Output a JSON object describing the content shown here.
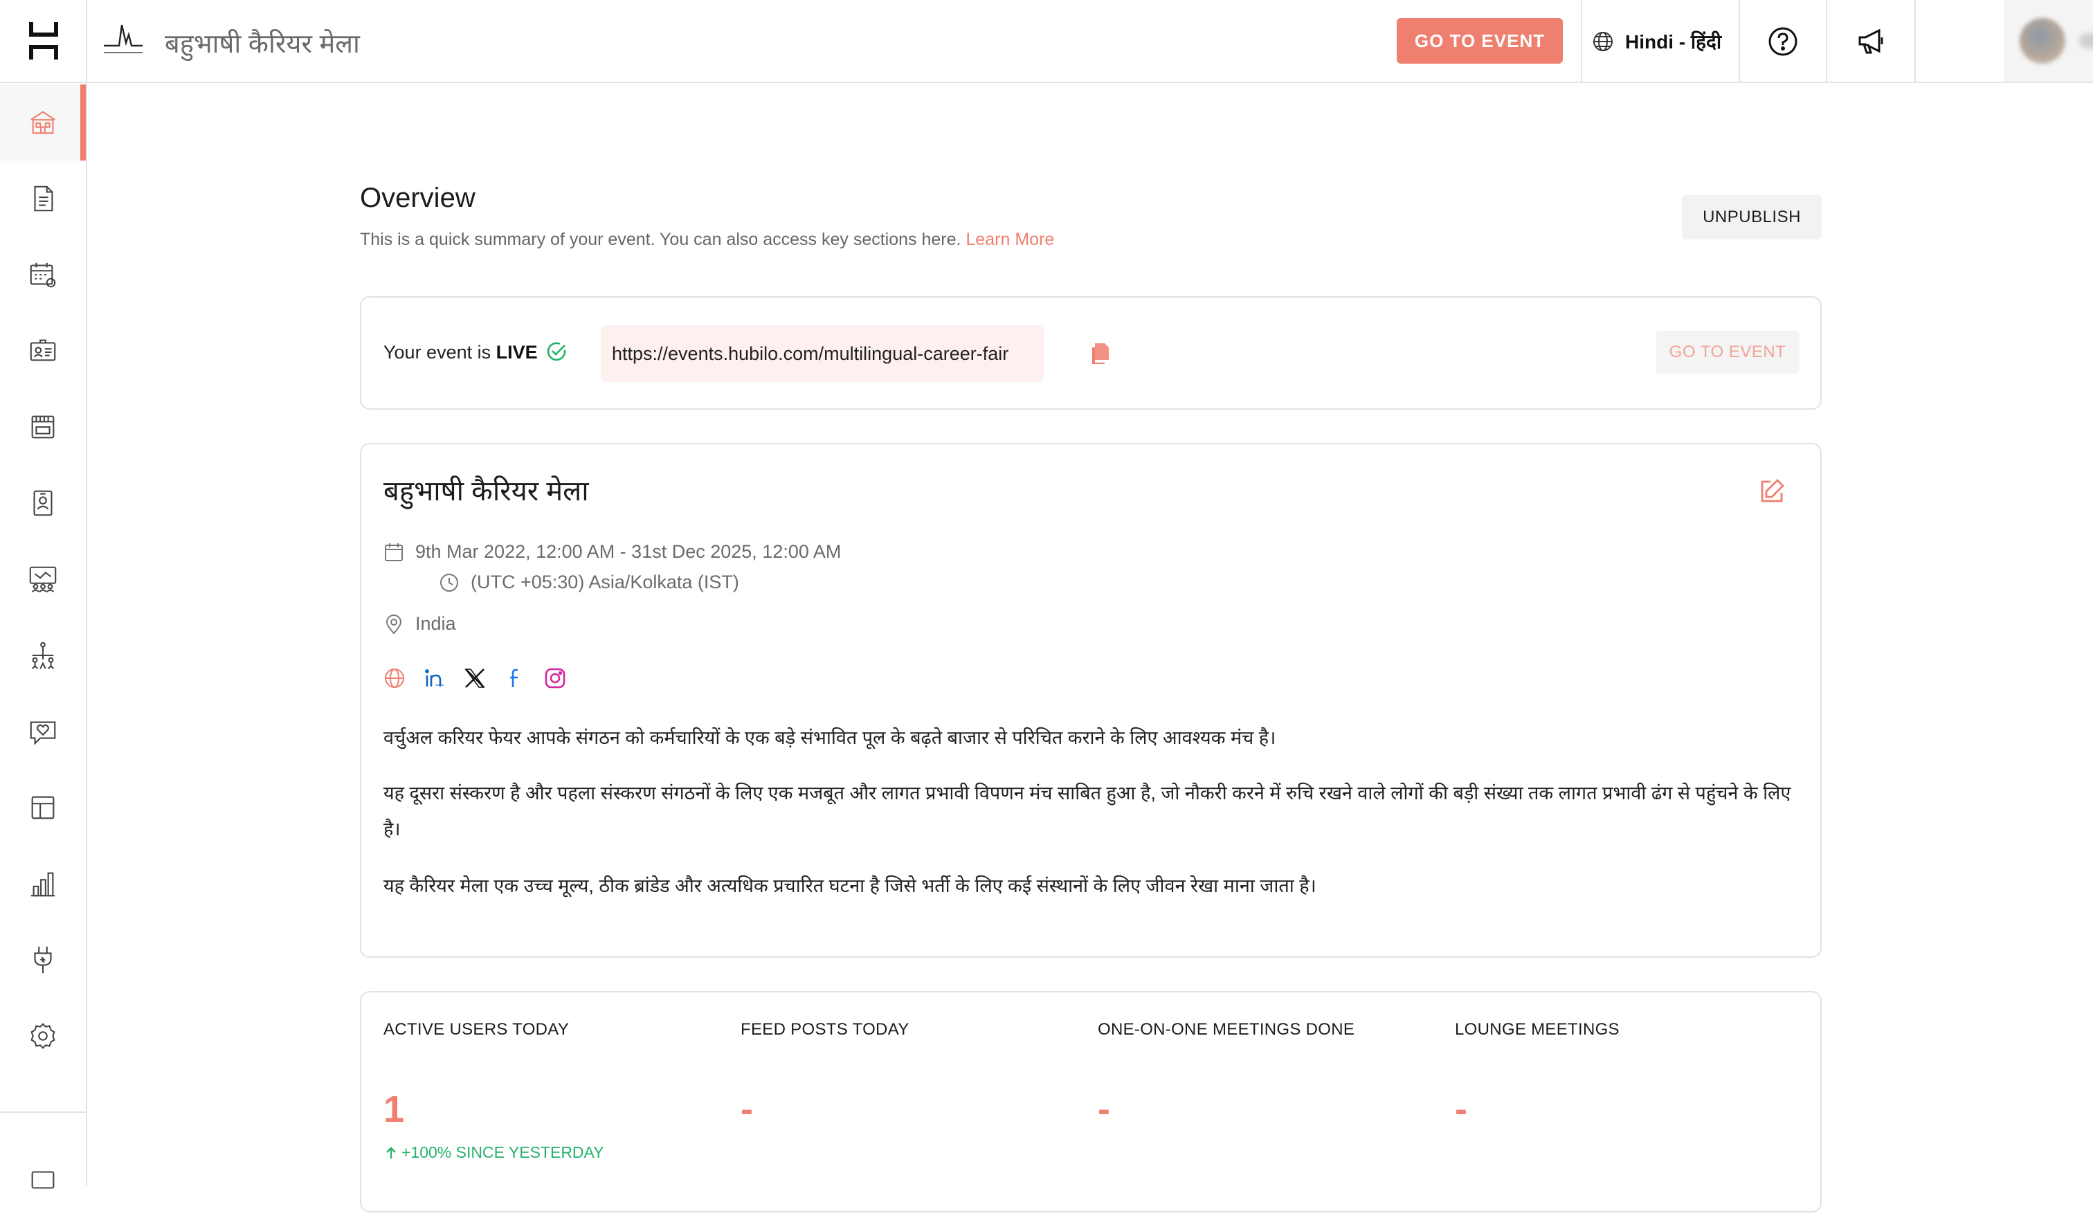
{
  "rail": {
    "items": [
      {
        "icon": "dashboard-icon",
        "active": true
      },
      {
        "icon": "document-icon",
        "active": false
      },
      {
        "icon": "calendar-settings-icon",
        "active": false
      },
      {
        "icon": "badge-icon",
        "active": false
      },
      {
        "icon": "booth-icon",
        "active": false
      },
      {
        "icon": "id-card-icon",
        "active": false
      },
      {
        "icon": "presentation-icon",
        "active": false
      },
      {
        "icon": "people-network-icon",
        "active": false
      },
      {
        "icon": "chat-heart-icon",
        "active": false
      },
      {
        "icon": "layout-icon",
        "active": false
      },
      {
        "icon": "analytics-icon",
        "active": false
      },
      {
        "icon": "plug-icon",
        "active": false
      },
      {
        "icon": "settings-icon",
        "active": false
      }
    ]
  },
  "header": {
    "event_title": "बहुभाषी कैरियर मेला",
    "go_to_event": "GO TO EVENT",
    "language": "Hindi - हिंदी"
  },
  "overview": {
    "title": "Overview",
    "subtitle": "This is a quick summary of your event. You can also access key sections here.",
    "learn_more": "Learn More",
    "unpublish": "UNPUBLISH"
  },
  "live": {
    "prefix": "Your event is ",
    "status": "LIVE",
    "url": "https://events.hubilo.com/multilingual-career-fair",
    "go_to_event": "GO TO EVENT"
  },
  "event": {
    "name": "बहुभाषी कैरियर मेला",
    "dates": "9th Mar 2022, 12:00 AM - 31st Dec 2025, 12:00 AM",
    "timezone": "(UTC +05:30) Asia/Kolkata (IST)",
    "location": "India",
    "social": [
      "website-icon",
      "linkedin-icon",
      "x-icon",
      "facebook-icon",
      "instagram-icon"
    ],
    "description": [
      "वर्चुअल करियर फेयर आपके संगठन को कर्मचारियों के एक बड़े संभावित पूल के बढ़ते बाजार से परिचित कराने के लिए आवश्यक मंच है।",
      "यह दूसरा संस्करण है और पहला संस्करण संगठनों के लिए एक मजबूत और लागत प्रभावी विपणन मंच साबित हुआ है, जो नौकरी करने में रुचि रखने वाले लोगों की बड़ी संख्या तक लागत प्रभावी ढंग से पहुंचने के लिए है।",
      "यह कैरियर मेला एक उच्च मूल्य, ठीक ब्रांडेड और अत्यधिक प्रचारित घटना है जिसे भर्ती के लिए कई संस्थानों के लिए जीवन रेखा माना जाता है।"
    ]
  },
  "stats": [
    {
      "label": "ACTIVE USERS TODAY",
      "value": "1"
    },
    {
      "label": "FEED POSTS TODAY",
      "value": "-"
    },
    {
      "label": "ONE-ON-ONE MEETINGS DONE",
      "value": "-"
    },
    {
      "label": "LOUNGE MEETINGS",
      "value": "-"
    }
  ],
  "stats_change": "+100% SINCE YESTERDAY",
  "colors": {
    "accent": "#ef7f6f",
    "success": "#25b26a",
    "linkedin": "#0a66c2",
    "facebook": "#1877f2",
    "instagram": "#d6249f"
  }
}
